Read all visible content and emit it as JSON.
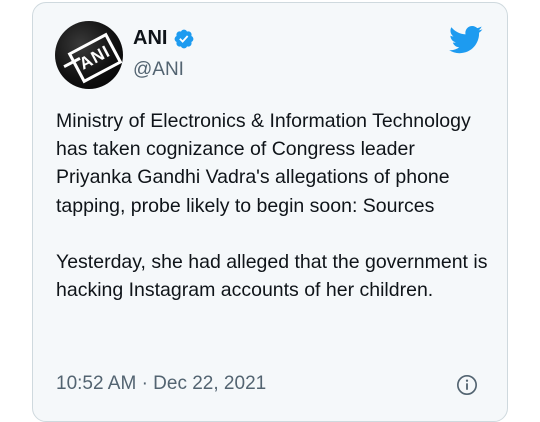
{
  "tweet": {
    "display_name": "ANI",
    "handle": "@ANI",
    "avatar_logo_text": "ANI",
    "verified": true,
    "paragraphs": [
      "Ministry of Electronics & Information Technology has taken cognizance of Congress leader Priyanka Gandhi Vadra's allegations of phone tapping, probe likely to begin soon: Sources",
      "Yesterday, she had alleged that the government is hacking Instagram accounts of her children."
    ],
    "time": "10:52 AM",
    "separator": "·",
    "date": "Dec 22, 2021"
  },
  "icons": {
    "verified": "verified-badge-icon",
    "platform": "twitter-bird-icon",
    "info": "info-icon"
  },
  "colors": {
    "accent": "#1d9bf0",
    "card_background": "#f5f8fa",
    "primary_text": "#0f1419",
    "secondary_text": "#536471"
  }
}
